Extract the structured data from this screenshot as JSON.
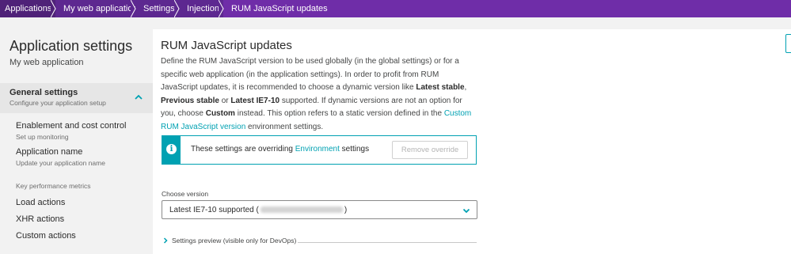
{
  "breadcrumb": [
    "Applications",
    "My web application",
    "Settings",
    "Injection",
    "RUM JavaScript updates"
  ],
  "sidebar": {
    "title": "Application settings",
    "subtitle": "My web application",
    "general": {
      "label": "General settings",
      "sub": "Configure your application setup"
    },
    "items": [
      {
        "label": "Enablement and cost control",
        "sub": "Set up monitoring"
      },
      {
        "label": "Application name",
        "sub": "Update your application name"
      }
    ],
    "heading": "Key performance metrics",
    "metrics": [
      "Load actions",
      "XHR actions",
      "Custom actions"
    ]
  },
  "main": {
    "title": "RUM JavaScript updates",
    "desc": {
      "p1": "Define the RUM JavaScript version to be used globally (in the global settings) or for a specific web application (in the application settings). In order to profit from RUM JavaScript updates, it is recommended to choose a dynamic version like ",
      "b1": "Latest stable",
      "p2": ", ",
      "b2": "Previous stable",
      "p3": " or ",
      "b3": "Latest IE7-10",
      "p4": " supported. If dynamic versions are not an option for you, choose ",
      "b4": "Custom",
      "p5": " instead. This option refers to a static version defined in the ",
      "link": "Custom RUM JavaScript version",
      "p6": " environment settings."
    },
    "notice": {
      "pre": "These settings are overriding ",
      "link": "Environment",
      "post": " settings",
      "button": "Remove override"
    },
    "version": {
      "label": "Choose version",
      "value_prefix": "Latest IE7-10 supported (",
      "value_suffix": ")"
    },
    "preview": "Settings preview (visible only for DevOps)"
  },
  "colors": {
    "brand_purple": "#6f2da8",
    "accent_teal": "#00a1b2"
  }
}
